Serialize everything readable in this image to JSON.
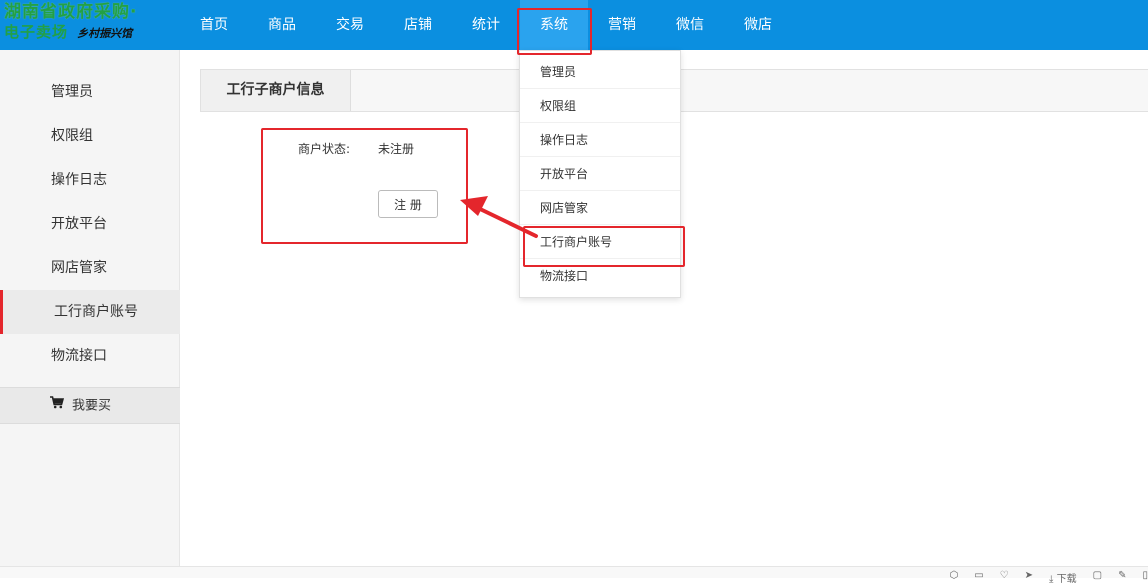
{
  "logo": {
    "line1": "湖南省政府采购·",
    "line2_main": "电子卖场",
    "line2_sub": "乡村振兴馆"
  },
  "nav": [
    {
      "label": "首页"
    },
    {
      "label": "商品"
    },
    {
      "label": "交易"
    },
    {
      "label": "店铺"
    },
    {
      "label": "统计"
    },
    {
      "label": "系统",
      "active": true
    },
    {
      "label": "营销"
    },
    {
      "label": "微信"
    },
    {
      "label": "微店"
    }
  ],
  "sidebar": {
    "items": [
      {
        "label": "管理员"
      },
      {
        "label": "权限组"
      },
      {
        "label": "操作日志"
      },
      {
        "label": "开放平台"
      },
      {
        "label": "网店管家"
      },
      {
        "label": "工行商户账号",
        "active": true
      },
      {
        "label": "物流接口"
      }
    ],
    "buy_label": "我要买"
  },
  "main": {
    "tab_label": "工行子商户信息",
    "status_label": "商户状态:",
    "status_value": "未注册",
    "register_button": "注 册"
  },
  "dropdown": {
    "items": [
      {
        "label": "管理员"
      },
      {
        "label": "权限组"
      },
      {
        "label": "操作日志"
      },
      {
        "label": "开放平台"
      },
      {
        "label": "网店管家"
      },
      {
        "label": "工行商户账号"
      },
      {
        "label": "物流接口"
      }
    ]
  },
  "colors": {
    "topbar": "#0b8fe0",
    "nav_active": "#2aa3ee",
    "annotation_red": "#e4262c",
    "logo_green": "#22a047"
  },
  "bottom_strip": {
    "download_label": "下载"
  }
}
